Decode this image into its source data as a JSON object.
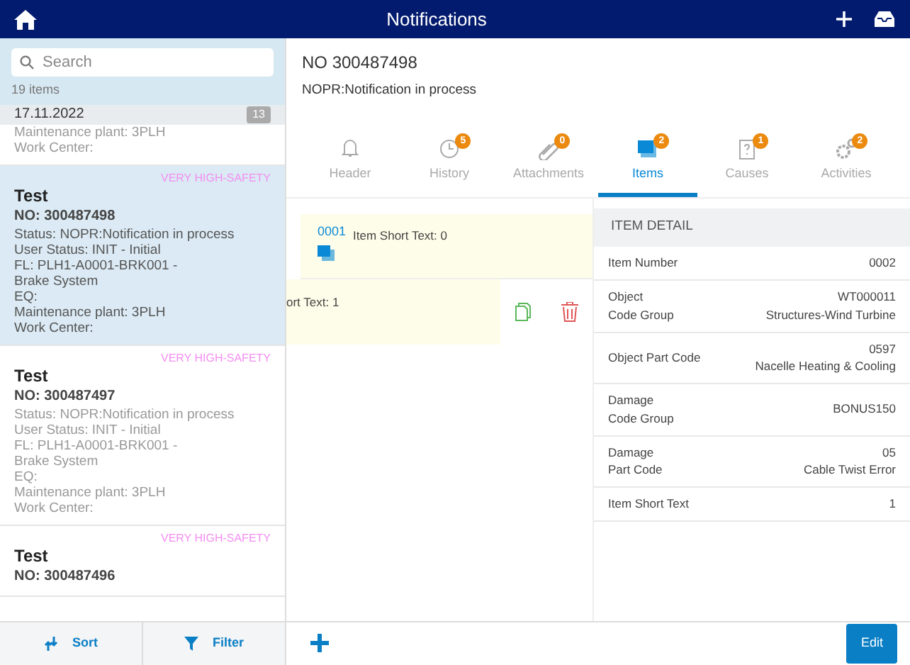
{
  "app_bar": {
    "title": "Notifications"
  },
  "sidebar": {
    "search": {
      "placeholder": "Search"
    },
    "count": "19 items",
    "group": {
      "date": "17.11.2022",
      "badge": "13"
    },
    "partial_item": {
      "lines": [
        "Maintenance plant: 3PLH",
        "Work Center:"
      ]
    },
    "notifications": [
      {
        "priority": "VERY HIGH-SAFETY",
        "title": "Test",
        "number": "NO: 300487498",
        "lines": [
          "Status: NOPR:Notification in process",
          "User Status: INIT - Initial",
          "FL: PLH1-A0001-BRK001 -",
          "Brake System",
          "EQ:",
          "Maintenance plant: 3PLH",
          "Work Center:"
        ],
        "selected": true
      },
      {
        "priority": "VERY HIGH-SAFETY",
        "title": "Test",
        "number": "NO: 300487497",
        "lines": [
          "Status: NOPR:Notification in process",
          "User Status: INIT - Initial",
          "FL: PLH1-A0001-BRK001 -",
          "Brake System",
          "EQ:",
          "Maintenance plant: 3PLH",
          "Work Center:"
        ],
        "selected": false
      },
      {
        "priority": "VERY HIGH-SAFETY",
        "title": "Test",
        "number": "NO: 300487496",
        "selected": false
      }
    ],
    "footer": [
      "Sort",
      "Filter"
    ]
  },
  "detail": {
    "title": "NO 300487498",
    "status": "NOPR:Notification in process",
    "tabs": [
      {
        "label": "Header",
        "kind": "bell",
        "selected": false
      },
      {
        "label": "History",
        "kind": "clock",
        "badge": "5",
        "selected": false
      },
      {
        "label": "Attachments",
        "kind": "clip",
        "badge": "0",
        "selected": false
      },
      {
        "label": "Items",
        "kind": "items",
        "badge": "2",
        "selected": true
      },
      {
        "label": "Causes",
        "kind": "cause",
        "badge": "1",
        "selected": false
      },
      {
        "label": "Activities",
        "kind": "gears",
        "badge": "2",
        "selected": false
      }
    ],
    "items": [
      {
        "kind": "normal",
        "number": "0001",
        "text": "Item Short Text: 0"
      },
      {
        "kind": "swiped",
        "text": "ort Text: 1"
      }
    ],
    "item_detail": {
      "heading": "ITEM DETAIL",
      "fields": [
        {
          "label": [
            "Item Number"
          ],
          "value": [
            "0002"
          ]
        },
        {
          "label": [
            "Object",
            "Code Group"
          ],
          "value": [
            "WT000011",
            "Structures-Wind Turbine"
          ]
        },
        {
          "label": [
            "Object Part Code"
          ],
          "value": [
            "0597",
            "Nacelle Heating & Cooling"
          ]
        },
        {
          "label": [
            "Damage",
            "Code Group"
          ],
          "value": [
            "BONUS150"
          ]
        },
        {
          "label": [
            "Damage",
            "Part Code"
          ],
          "value": [
            "05",
            "Cable Twist Error"
          ]
        },
        {
          "label": [
            "Item Short Text"
          ],
          "value": [
            "1"
          ]
        }
      ]
    },
    "edit_button": "Edit"
  }
}
